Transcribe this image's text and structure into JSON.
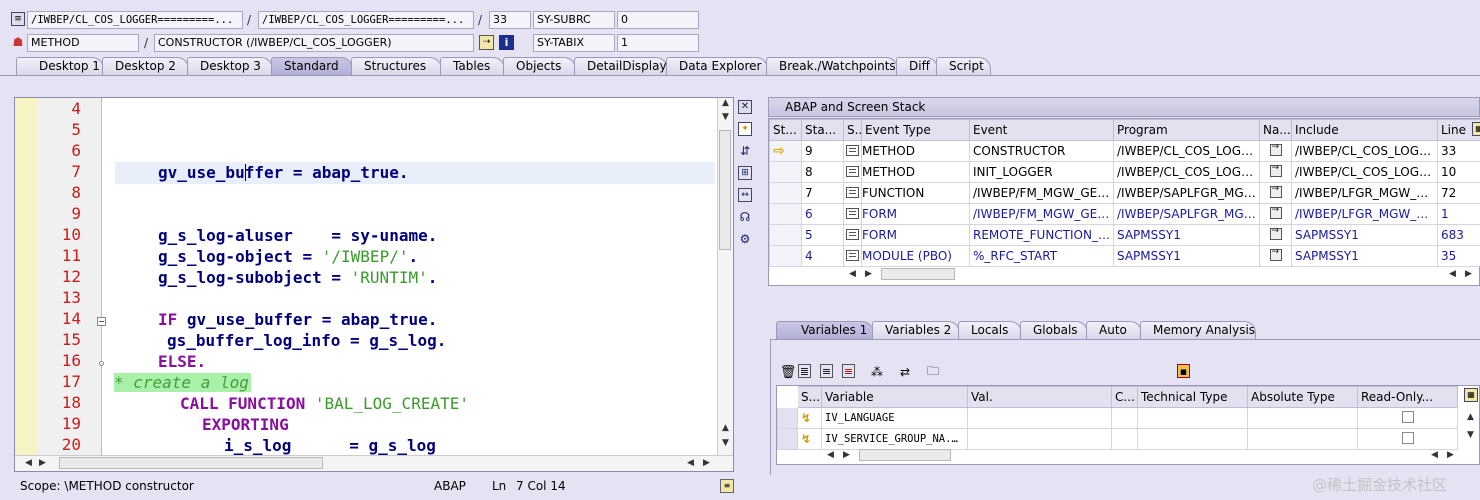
{
  "header": {
    "row1": {
      "field1": "/IWBEP/CL_COS_LOGGER=========...",
      "sep1": "/",
      "field2": "/IWBEP/CL_COS_LOGGER=========...",
      "sep2": "/",
      "field3": "33",
      "sysvar_name": "SY-SUBRC",
      "sysvar_value": "0"
    },
    "row2": {
      "field1": "METHOD",
      "sep1": "/",
      "field2": "CONSTRUCTOR (/IWBEP/CL_COS_LOGGER)",
      "sysvar_name": "SY-TABIX",
      "sysvar_value": "1"
    }
  },
  "tabs": [
    {
      "label": "Desktop 1"
    },
    {
      "label": "Desktop 2"
    },
    {
      "label": "Desktop 3"
    },
    {
      "label": "Standard",
      "active": true
    },
    {
      "label": "Structures"
    },
    {
      "label": "Tables"
    },
    {
      "label": "Objects"
    },
    {
      "label": "DetailDisplay"
    },
    {
      "label": "Data Explorer"
    },
    {
      "label": "Break./Watchpoints"
    },
    {
      "label": "Diff"
    },
    {
      "label": "Script"
    }
  ],
  "editor": {
    "line_numbers": [
      "4",
      "5",
      "6",
      "7",
      "8",
      "9",
      "10",
      "11",
      "12",
      "13",
      "14",
      "15",
      "16",
      "17",
      "18",
      "19",
      "20"
    ],
    "lines": {
      "l7a": "gv_use_bu",
      "l7b": "ffer = ",
      "l7c": "abap_true.",
      "l10a": "g_s_log-aluser    = ",
      "l10b": "sy-uname.",
      "l11a": "g_s_log-object = ",
      "l11b": "'/IWBEP/'",
      "l11c": ".",
      "l12a": "g_s_log-subobject = ",
      "l12b": "'RUNTIM'",
      "l12c": ".",
      "l14a": "IF ",
      "l14b": "gv_use_buffer = abap_true.",
      "l15": "gs_buffer_log_info = g_s_log.",
      "l16": "ELSE.",
      "l17": "* create a log",
      "l18a": "CALL FUNCTION ",
      "l18b": "'BAL_LOG_CREATE'",
      "l19": "EXPORTING",
      "l20": "i_s_log      = g_s_log"
    }
  },
  "status_bar": {
    "scope": "Scope: \\METHOD constructor",
    "lang": "ABAP",
    "pos_label": "Ln",
    "pos_value": "7 Col 14"
  },
  "stack": {
    "title": "ABAP and Screen Stack",
    "columns": [
      "St...",
      "Sta...",
      "S...",
      "Event Type",
      "Event",
      "Program",
      "Na...",
      "Include",
      "Line"
    ],
    "rows": [
      {
        "level": "9",
        "event_type": "METHOD",
        "event": "CONSTRUCTOR",
        "program": "/IWBEP/CL_COS_LOGGE...",
        "include": "/IWBEP/CL_COS_LOGGE...",
        "line": "33",
        "current": true,
        "style": ""
      },
      {
        "level": "8",
        "event_type": "METHOD",
        "event": "INIT_LOGGER",
        "program": "/IWBEP/CL_COS_LOGGE...",
        "include": "/IWBEP/CL_COS_LOGGE...",
        "line": "10",
        "current": false,
        "style": ""
      },
      {
        "level": "7",
        "event_type": "FUNCTION",
        "event": "/IWBEP/FM_MGW_GET_...",
        "program": "/IWBEP/SAPLFGR_MGW...",
        "include": "/IWBEP/LFGR_MGW_CLI...",
        "line": "72",
        "current": false,
        "style": ""
      },
      {
        "level": "6",
        "event_type": "FORM",
        "event": "/IWBEP/FM_MGW_GET_...",
        "program": "/IWBEP/SAPLFGR_MGW...",
        "include": "/IWBEP/LFGR_MGW_CLI...",
        "line": "1",
        "current": false,
        "style": "blue"
      },
      {
        "level": "5",
        "event_type": "FORM",
        "event": "REMOTE_FUNCTION_CA...",
        "program": "SAPMSSY1",
        "include": "SAPMSSY1",
        "line": "683",
        "current": false,
        "style": "blue"
      },
      {
        "level": "4",
        "event_type": "MODULE (PBO)",
        "event": "%_RFC_START",
        "program": "SAPMSSY1",
        "include": "SAPMSSY1",
        "line": "35",
        "current": false,
        "style": "blue"
      }
    ]
  },
  "var_tabs": [
    {
      "label": "Variables 1",
      "active": true
    },
    {
      "label": "Variables 2"
    },
    {
      "label": "Locals"
    },
    {
      "label": "Globals"
    },
    {
      "label": "Auto"
    },
    {
      "label": "Memory Analysis"
    }
  ],
  "variables": {
    "columns": [
      "S...",
      "Variable",
      "Val.",
      "C...",
      "Technical Type",
      "Absolute Type",
      "Read-Only..."
    ],
    "rows": [
      {
        "name": "IV_LANGUAGE"
      },
      {
        "name": "IV_SERVICE_GROUP_NA..."
      }
    ]
  },
  "watermark": "@稀土掘金技术社区",
  "colors": {
    "background": "#e4e2f3",
    "line_number": "#cc1c1c",
    "keyword": "#8a0ea0",
    "string": "#3a9b2a",
    "comment_bg": "#a9f0a9"
  }
}
